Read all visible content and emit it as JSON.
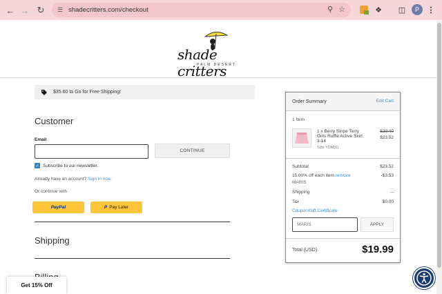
{
  "browser": {
    "url": "shadecritters.com/checkout",
    "profile_initial": "P"
  },
  "header": {
    "logo_text": "shade critters",
    "logo_sub": "PALM DESERT"
  },
  "banner": {
    "text": "$35.60 to Go for Free Shipping!"
  },
  "customer": {
    "title": "Customer",
    "email_label": "Email",
    "email_value": "",
    "continue_label": "CONTINUE",
    "newsletter_label": "Subscribe to our newsletter.",
    "account_prompt": "Already have an account?",
    "sign_in_label": "Sign in now.",
    "or_continue": "Or continue with",
    "paypal_label": "PayPal",
    "paylater_label": "Pay Later"
  },
  "shipping": {
    "title": "Shipping"
  },
  "billing": {
    "title": "Billing"
  },
  "promo_tab": {
    "label": "Get 15% Off"
  },
  "summary": {
    "title": "Order Summary",
    "edit_cart": "Edit Cart",
    "items_count": "1 Item",
    "product": {
      "name": "1 x Berry Stripe Terry Girls Ruffle Active Skirt 3-14",
      "size": "Size YDM(6)",
      "price_old": "$29.40",
      "price_new": "$23.52"
    },
    "subtotal_label": "Subtotal",
    "subtotal_value": "$23.52",
    "discount_label": "15.00% off each item",
    "discount_remove": "remove",
    "discount_code": "MARIS",
    "discount_value": "-$3.53",
    "shipping_label": "Shipping",
    "shipping_value": "--",
    "tax_label": "Tax",
    "tax_value": "$0.00",
    "coupon_link": "Coupon/Gift Certificate",
    "coupon_value": "MARIS",
    "apply_label": "APPLY",
    "total_label": "Total (USD)",
    "total_value": "$19.99"
  },
  "colors": {
    "chrome": "#f6d6da",
    "link": "#3b8fd9",
    "paypal_yellow": "#ffc439",
    "accessibility_blue": "#1a3c6e"
  }
}
